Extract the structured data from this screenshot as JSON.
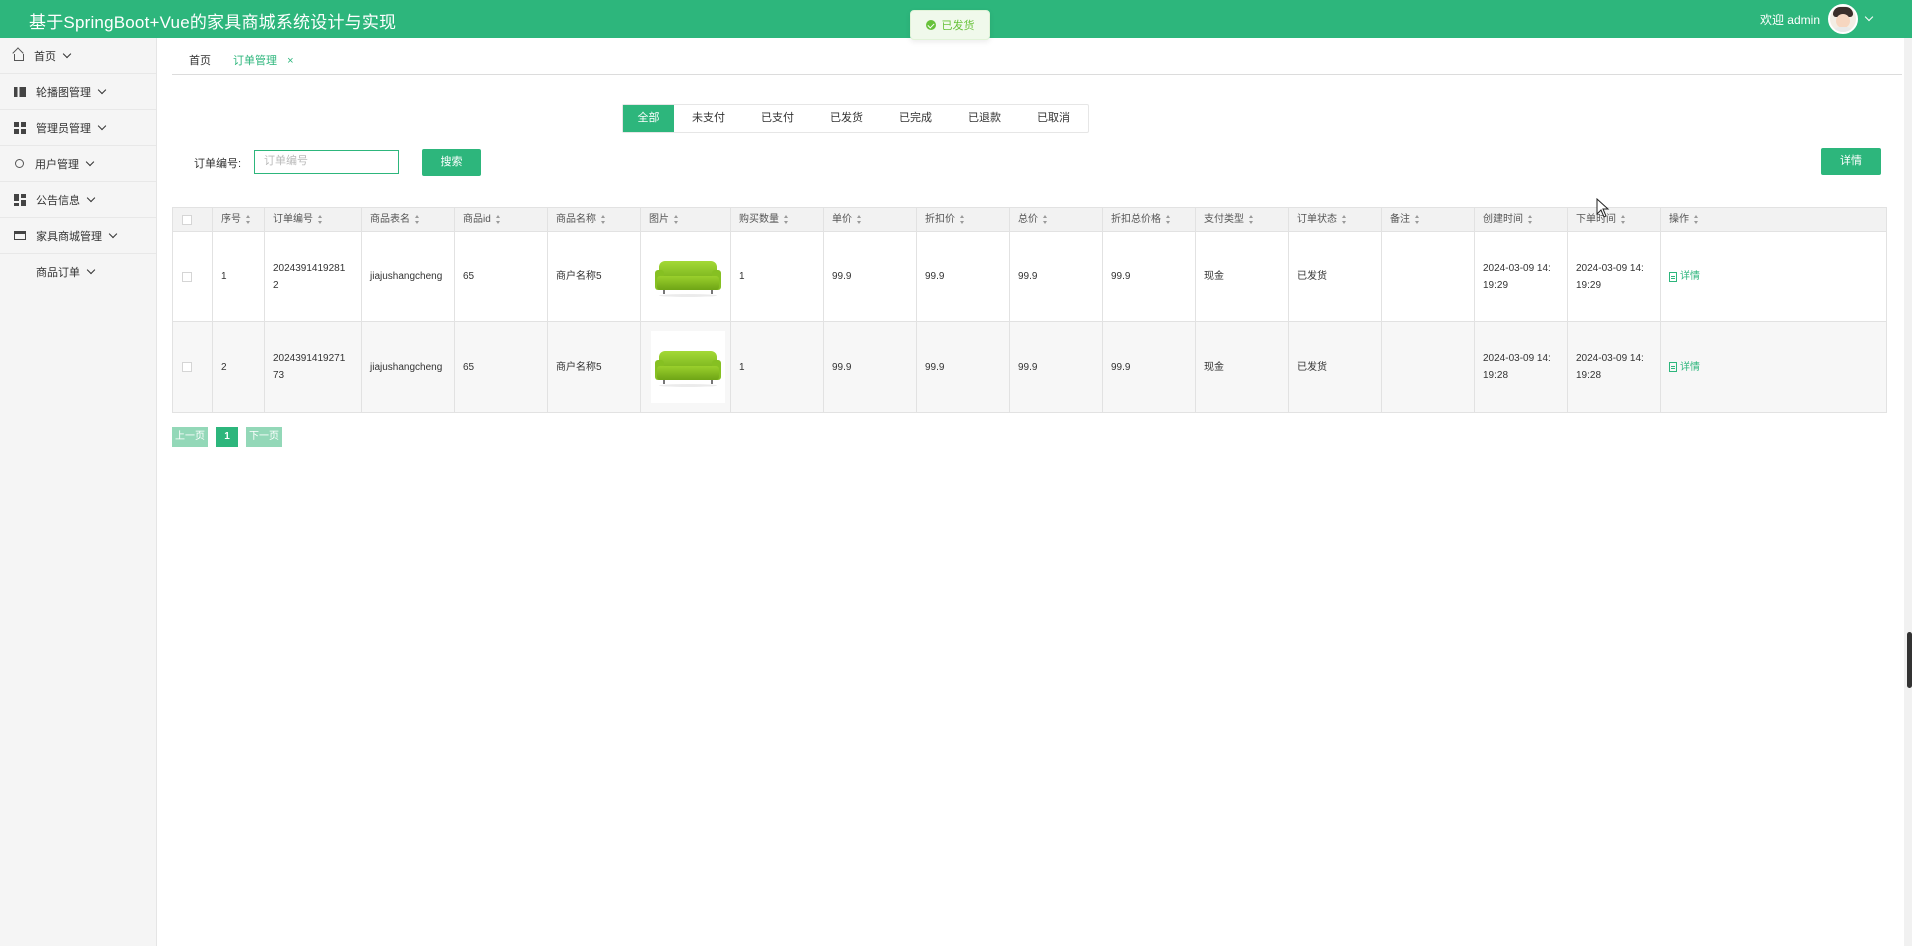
{
  "app": {
    "title": "基于SpringBoot+Vue的家具商城系统设计与实现"
  },
  "user": {
    "welcome": "欢迎 admin"
  },
  "toast": {
    "message": "已发货"
  },
  "sidebar": {
    "items": [
      {
        "label": "首页",
        "icon": "home-icon"
      },
      {
        "label": "轮播图管理",
        "icon": "carousel-icon"
      },
      {
        "label": "管理员管理",
        "icon": "grid-icon"
      },
      {
        "label": "用户管理",
        "icon": "user-icon"
      },
      {
        "label": "公告信息",
        "icon": "dashboard-icon"
      },
      {
        "label": "家具商城管理",
        "icon": "box-icon"
      }
    ],
    "subitem": {
      "label": "商品订单"
    }
  },
  "tabs": {
    "home": "首页",
    "orders": "订单管理",
    "close": "×"
  },
  "filters": [
    "全部",
    "未支付",
    "已支付",
    "已发货",
    "已完成",
    "已退款",
    "已取消"
  ],
  "search": {
    "label": "订单编号:",
    "placeholder": "订单编号",
    "button": "搜索"
  },
  "actions": {
    "detail_button": "详情"
  },
  "table": {
    "headers": [
      "序号",
      "订单编号",
      "商品表名",
      "商品id",
      "商品名称",
      "图片",
      "购买数量",
      "单价",
      "折扣价",
      "总价",
      "折扣总价格",
      "支付类型",
      "订单状态",
      "备注",
      "创建时间",
      "下单时间",
      "操作"
    ],
    "rows": [
      {
        "index": "1",
        "order_no_1": "2024391419281",
        "order_no_2": "2",
        "table_name": "jiajushangcheng",
        "goods_id": "65",
        "goods_name": "商户名称5",
        "qty": "1",
        "price": "99.9",
        "discount_price": "99.9",
        "total": "99.9",
        "discount_total": "99.9",
        "pay_type": "现金",
        "status": "已发货",
        "remark": "",
        "created_1": "2024-03-09 14:",
        "created_2": "19:29",
        "ordered_1": "2024-03-09 14:",
        "ordered_2": "19:29",
        "op": "详情"
      },
      {
        "index": "2",
        "order_no_1": "2024391419271",
        "order_no_2": "73",
        "table_name": "jiajushangcheng",
        "goods_id": "65",
        "goods_name": "商户名称5",
        "qty": "1",
        "price": "99.9",
        "discount_price": "99.9",
        "total": "99.9",
        "discount_total": "99.9",
        "pay_type": "现金",
        "status": "已发货",
        "remark": "",
        "created_1": "2024-03-09 14:",
        "created_2": "19:28",
        "ordered_1": "2024-03-09 14:",
        "ordered_2": "19:28",
        "op": "详情"
      }
    ]
  },
  "pager": {
    "prev": "上一页",
    "page": "1",
    "next": "下一页"
  },
  "colors": {
    "primary": "#2db67c",
    "success_toast": "#67c23a"
  }
}
